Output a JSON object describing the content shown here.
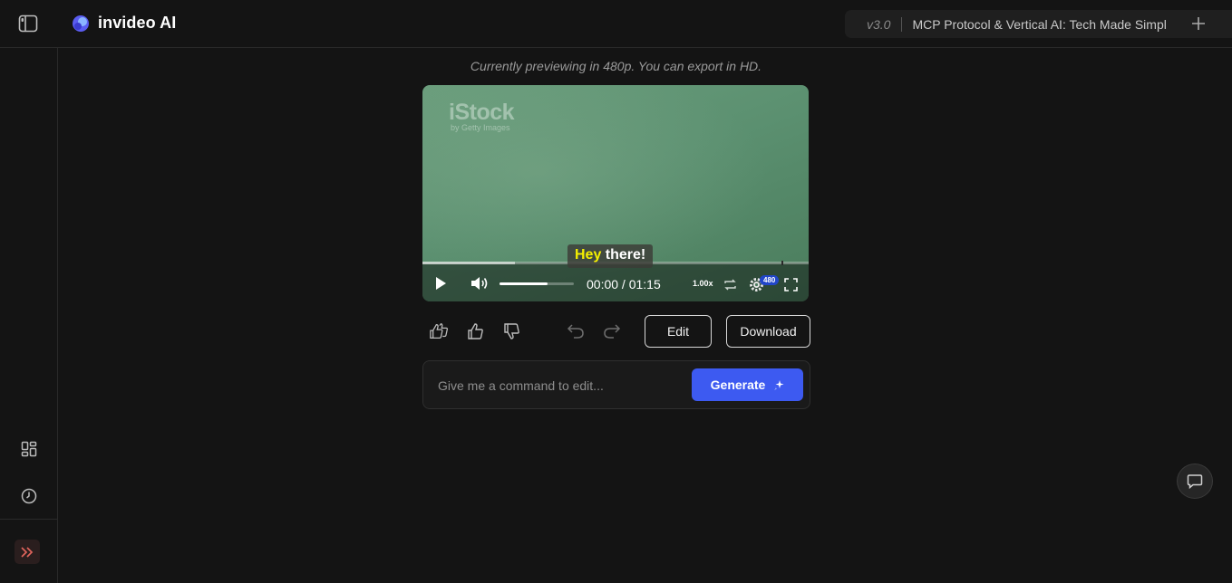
{
  "header": {
    "brand": "invideo AI",
    "version": "v3.0",
    "project_title": "MCP Protocol & Vertical AI: Tech Made Simpl",
    "icons": [
      "sidebar-toggle-icon",
      "invideo-logo-icon",
      "plus-icon"
    ]
  },
  "sidebar": {
    "icons": [
      "grid-icon",
      "history-icon",
      "double-chevron-right-icon"
    ]
  },
  "preview": {
    "note": "Currently previewing in 480p. You can export in HD.",
    "watermark_main": "iStock",
    "watermark_sub": "by Getty Images",
    "caption_highlight": "Hey",
    "caption_rest": " there!",
    "timecode": "00:00 / 01:15",
    "speed": "1.00x",
    "quality": "480",
    "volume_level": 0.65,
    "buffer_fraction": 0.24
  },
  "actions": {
    "edit_label": "Edit",
    "download_label": "Download",
    "icons": [
      "double-thumbs-up-icon",
      "thumbs-up-icon",
      "thumbs-down-icon",
      "undo-icon",
      "redo-icon"
    ]
  },
  "command": {
    "placeholder": "Give me a command to edit...",
    "generate_label": "Generate"
  },
  "colors": {
    "background": "#141414",
    "accent": "#3d5af1",
    "caption_highlight": "#f5f000",
    "quality_badge": "#2146c9"
  }
}
